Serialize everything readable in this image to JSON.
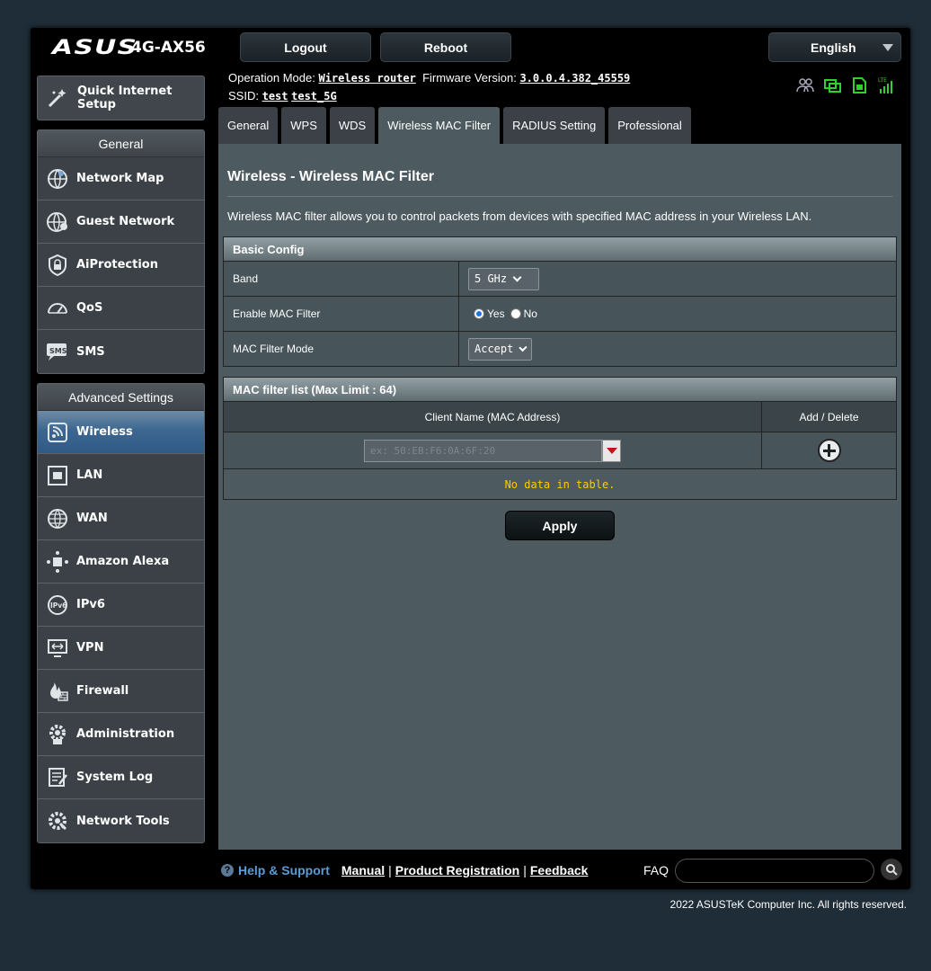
{
  "header": {
    "logo": "ASUS",
    "model": "4G-AX56",
    "logout_label": "Logout",
    "reboot_label": "Reboot",
    "language": "English"
  },
  "info": {
    "op_mode_label": "Operation Mode:",
    "op_mode_value": "Wireless router",
    "firmware_label": "Firmware Version:",
    "firmware_value": "3.0.0.4.382_45559",
    "ssid_label": "SSID:",
    "ssid_1": "test",
    "ssid_2": "test_5G"
  },
  "status_icons": [
    "clients-icon",
    "network-icon",
    "sim-icon",
    "lte-signal-icon"
  ],
  "sidebar": {
    "qis_label_1": "Quick Internet",
    "qis_label_2": "Setup",
    "general_title": "General",
    "general_items": [
      {
        "label": "Network Map",
        "icon": "network-map-icon"
      },
      {
        "label": "Guest Network",
        "icon": "guest-network-icon"
      },
      {
        "label": "AiProtection",
        "icon": "shield-lock-icon"
      },
      {
        "label": "QoS",
        "icon": "speedometer-icon"
      },
      {
        "label": "SMS",
        "icon": "sms-icon"
      }
    ],
    "advanced_title": "Advanced Settings",
    "advanced_items": [
      {
        "label": "Wireless",
        "icon": "wifi-icon"
      },
      {
        "label": "LAN",
        "icon": "lan-icon"
      },
      {
        "label": "WAN",
        "icon": "globe-icon"
      },
      {
        "label": "Amazon Alexa",
        "icon": "alexa-icon"
      },
      {
        "label": "IPv6",
        "icon": "ipv6-icon"
      },
      {
        "label": "VPN",
        "icon": "vpn-icon"
      },
      {
        "label": "Firewall",
        "icon": "firewall-icon"
      },
      {
        "label": "Administration",
        "icon": "gear-icon"
      },
      {
        "label": "System Log",
        "icon": "log-icon"
      },
      {
        "label": "Network Tools",
        "icon": "tools-icon"
      }
    ]
  },
  "tabs": [
    "General",
    "WPS",
    "WDS",
    "Wireless MAC Filter",
    "RADIUS Setting",
    "Professional"
  ],
  "content": {
    "title": "Wireless - Wireless MAC Filter",
    "description": "Wireless MAC filter allows you to control packets from devices with specified MAC address in your Wireless LAN.",
    "basic_config": "Basic Config",
    "band_label": "Band",
    "band_value": "5 GHz",
    "enable_label": "Enable MAC Filter",
    "yes_label": "Yes",
    "no_label": "No",
    "mode_label": "MAC Filter Mode",
    "mode_value": "Accept",
    "list_title": "MAC filter list (Max Limit : 64)",
    "col_client": "Client Name (MAC Address)",
    "col_add": "Add / Delete",
    "mac_placeholder": "ex: 50:EB:F6:0A:6F:20",
    "no_data": "No data in table.",
    "apply_label": "Apply"
  },
  "footer": {
    "help": "Help & Support",
    "manual": "Manual",
    "product_reg": "Product Registration",
    "feedback": "Feedback",
    "sep": "|",
    "faq": "FAQ",
    "copyright": "2022 ASUSTeK Computer Inc. All rights reserved."
  }
}
